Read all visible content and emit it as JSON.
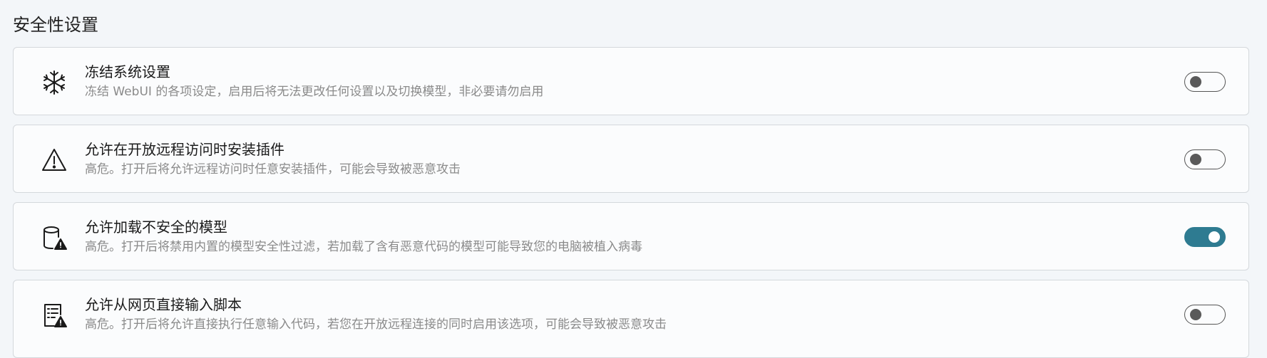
{
  "section": {
    "title": "安全性设置"
  },
  "settings": [
    {
      "title": "冻结系统设置",
      "description": "冻结 WebUI 的各项设定，启用后将无法更改任何设置以及切换模型，非必要请勿启用",
      "icon": "snowflake-icon",
      "enabled": false
    },
    {
      "title": "允许在开放远程访问时安装插件",
      "description": "高危。打开后将允许远程访问时任意安装插件，可能会导致被恶意攻击",
      "icon": "warning-icon",
      "enabled": false
    },
    {
      "title": "允许加载不安全的模型",
      "description": "高危。打开后将禁用内置的模型安全性过滤，若加载了含有恶意代码的模型可能导致您的电脑被植入病毒",
      "icon": "database-warning-icon",
      "enabled": true
    },
    {
      "title": "允许从网页直接输入脚本",
      "description": "高危。打开后将允许直接执行任意输入代码，若您在开放远程连接的同时启用该选项，可能会导致被恶意攻击",
      "icon": "script-warning-icon",
      "enabled": false
    }
  ],
  "colors": {
    "toggle_on": "#2e7b91",
    "toggle_off_border": "#555555",
    "card_border": "#d4d8dc",
    "page_background": "#f3f6f9"
  }
}
